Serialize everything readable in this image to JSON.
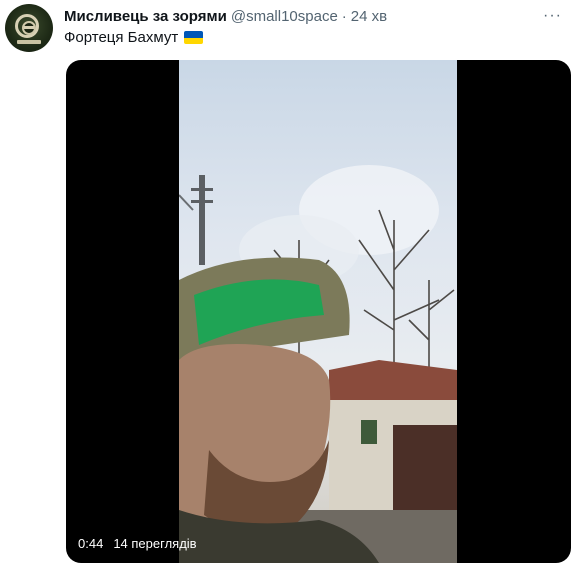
{
  "tweet": {
    "author_name": "Мисливець за зорями",
    "handle": "@small10space",
    "separator": "·",
    "time": "24 хв",
    "text": "Фортеця Бахмут",
    "flag": "ukraine-flag",
    "more_icon": "···"
  },
  "video": {
    "duration": "0:44",
    "views": "14 переглядів"
  }
}
